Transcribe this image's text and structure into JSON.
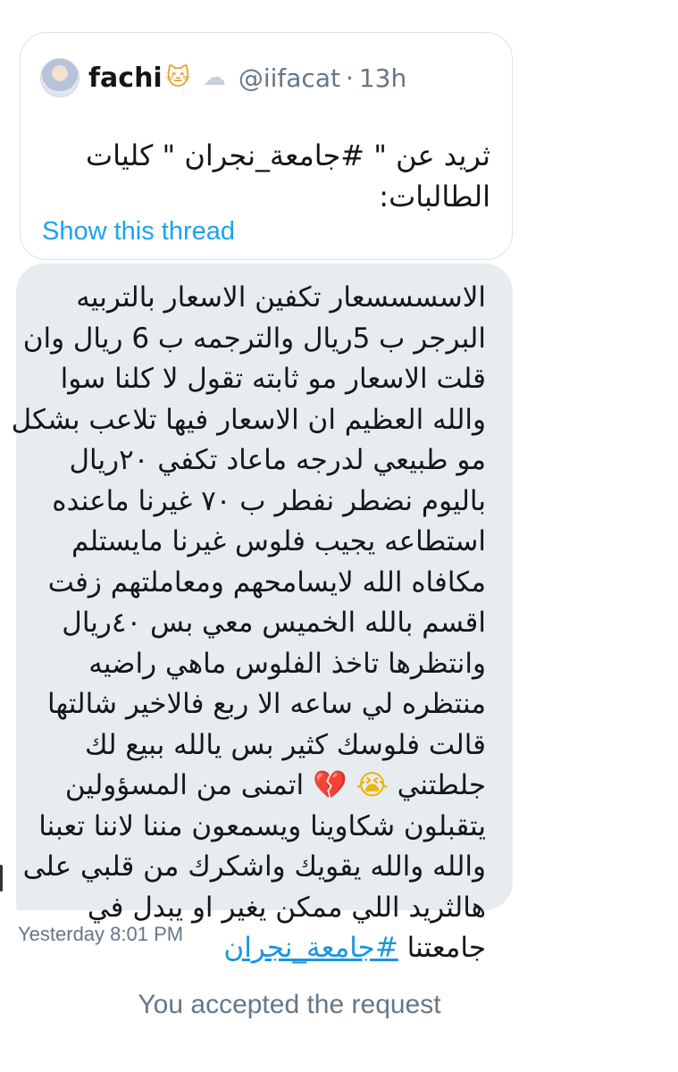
{
  "quoted_tweet": {
    "display_name": "fachi",
    "name_emojis": [
      "🐱",
      "☁"
    ],
    "handle": "@iifacat",
    "separator": "·",
    "time": "13h",
    "text": "ثريد عن \" #جامعة_نجران \" كليات الطالبات:",
    "show_thread_label": "Show this thread"
  },
  "message": {
    "lines": [
      "الاسسسسعار تكفين الاسعار بالتربيه",
      "البرجر ب 5ريال والترجمه ب 6 ريال وان",
      "قلت الاسعار مو ثابته تقول لا كلنا سوا",
      "والله العظيم ان الاسعار فيها تلاعب بشكل",
      "مو طبيعي لدرجه ماعاد تكفي ٢٠ريال",
      "باليوم نضطر نفطر ب ٧٠ غيرنا ماعنده",
      "استطاعه يجيب فلوس غيرنا مايستلم",
      "مكافاه الله لايسامحهم ومعاملتهم زفت",
      "اقسم بالله الخميس معي بس ٤٠ريال",
      "وانتظرها تاخذ الفلوس ماهي راضيه",
      "منتظره لي ساعه الا ربع فالاخير شالتها",
      "قالت فلوسك كثير بس يالله ببيع لك"
    ],
    "line_13_text": "جلطتني",
    "emoji_crying": "😭",
    "emoji_broken_heart": "💔",
    "line_13_rest": "اتمنى من المسؤولين",
    "lines_after": [
      "يتقبلون شكاوينا ويسمعون مننا لاننا تعبنا",
      "والله والله يقويك واشكرك من قلبي على",
      "هالثريد اللي ممكن يغير او يبدل في"
    ],
    "last_line_text": "جامعتنا",
    "hashtag": "#جامعة_نجران",
    "timestamp": "Yesterday 8:01 PM"
  },
  "notice": "You accepted the request",
  "colors": {
    "link": "#1da1f2",
    "bubble": "#e6ecf0",
    "muted": "#657786"
  }
}
